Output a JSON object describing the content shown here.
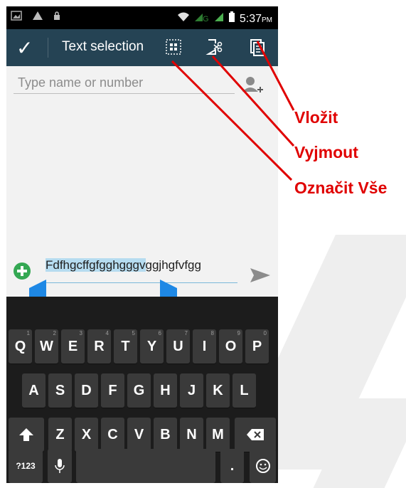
{
  "status_bar": {
    "time": "5:37",
    "ampm": "PM"
  },
  "action_bar": {
    "title": "Text selection"
  },
  "compose": {
    "recipient_placeholder": "Type name or number",
    "message_selected": "Fdfhgcffgfgghgggv",
    "message_rest": "ggjhgfvfgg"
  },
  "keyboard": {
    "row1": [
      "Q",
      "W",
      "E",
      "R",
      "T",
      "Y",
      "U",
      "I",
      "O",
      "P"
    ],
    "row1_nums": [
      "1",
      "2",
      "3",
      "4",
      "5",
      "6",
      "7",
      "8",
      "9",
      "0"
    ],
    "row2": [
      "A",
      "S",
      "D",
      "F",
      "G",
      "H",
      "J",
      "K",
      "L"
    ],
    "row3": [
      "Z",
      "X",
      "C",
      "V",
      "B",
      "N",
      "M"
    ],
    "symbols_key": "?123",
    "period_key": "."
  },
  "annotations": {
    "paste": "Vložit",
    "cut": "Vyjmout",
    "select_all": "Označit Vše"
  },
  "colors": {
    "action_bar": "#254354",
    "annotation": "#e00000",
    "selection": "#b6dcf0",
    "handle": "#1e88e5"
  }
}
